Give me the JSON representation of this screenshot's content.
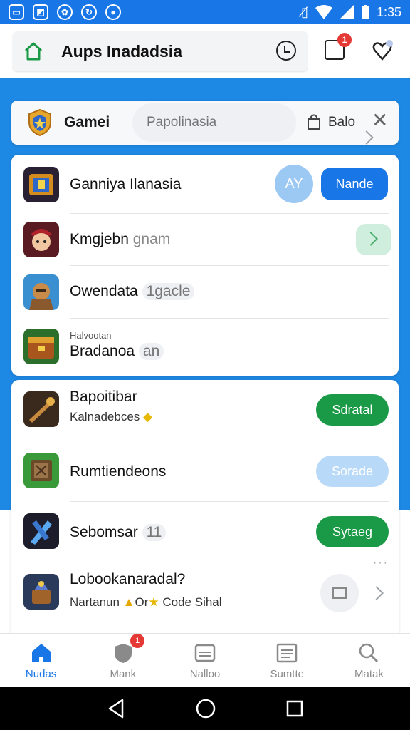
{
  "status_bar": {
    "time": "1:35",
    "icons": [
      "screen-icon",
      "photo-icon",
      "vpn-icon",
      "sync-icon",
      "chat-icon",
      "vibrate-icon",
      "wifi-icon",
      "signal-icon",
      "battery-icon"
    ]
  },
  "app_bar": {
    "title": "Aups Inadadsia",
    "notification_count": "1"
  },
  "search_bar": {
    "label": "Gamei",
    "placeholder": "Papolinasia",
    "bag_label": "Balo"
  },
  "featured_list": [
    {
      "title": "Ganniya Ilanasia",
      "avatar": "AY",
      "button": "Nande"
    },
    {
      "title": "Kmgjebn",
      "subtitle": "gnam"
    },
    {
      "title": "Owendata",
      "subtitle": "1gacle"
    },
    {
      "small": "Halvootan",
      "title": "Bradanoa",
      "subtitle": "an"
    }
  ],
  "app_list": [
    {
      "title": "Bapoitibar",
      "desc": "Kalnadebces",
      "button": "Sdratal"
    },
    {
      "title": "Rumtiendeons",
      "button": "Sorade"
    },
    {
      "title": "Sebomsar",
      "subtitle": "11",
      "button": "Sytaeg"
    },
    {
      "title": "Lobookanaradal?",
      "desc": "Nartanun",
      "desc2": "Or",
      "desc3": "Code Sihal"
    }
  ],
  "bottom_nav": {
    "items": [
      {
        "label": "Nudas",
        "icon": "home-icon"
      },
      {
        "label": "Mank",
        "icon": "shield-icon",
        "badge": "1"
      },
      {
        "label": "Nalloo",
        "icon": "card-icon"
      },
      {
        "label": "Sumtte",
        "icon": "list-icon"
      },
      {
        "label": "Matak",
        "icon": "search-icon"
      }
    ]
  },
  "colors": {
    "primary": "#1976e6",
    "band": "#1e88e5",
    "green": "#1a9a47",
    "badge": "#e53935"
  }
}
